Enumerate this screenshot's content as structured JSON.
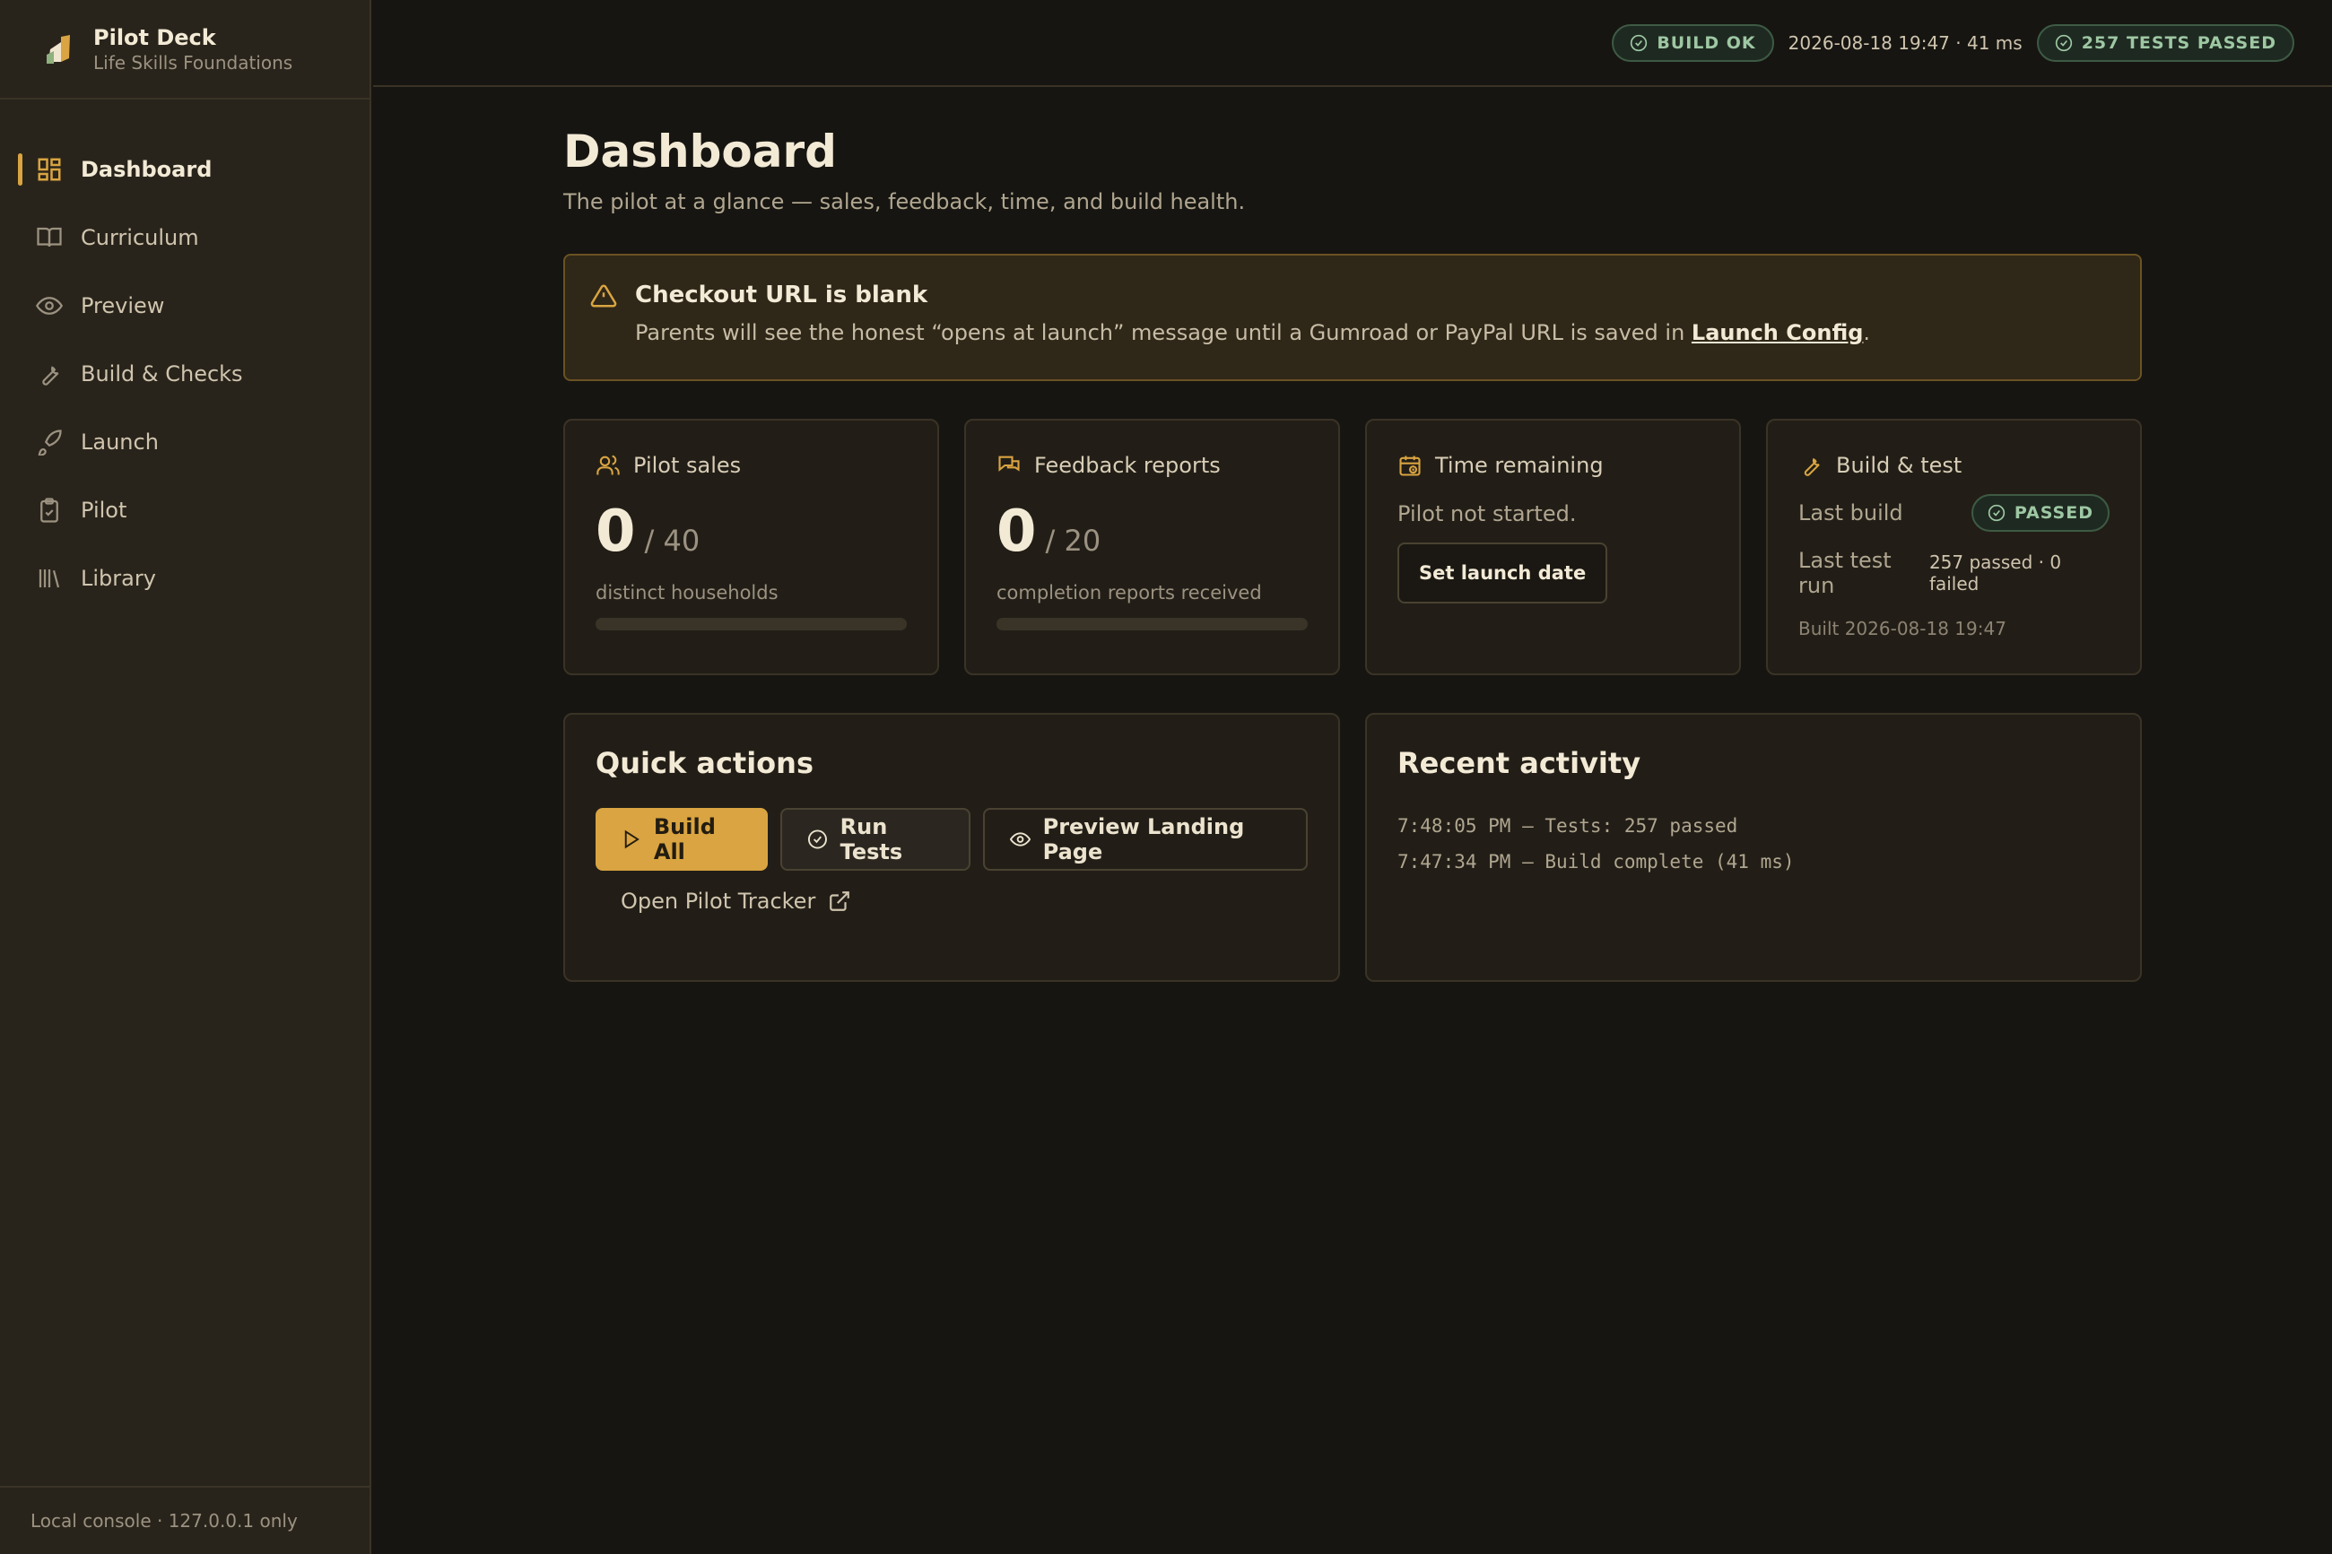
{
  "brand": {
    "name": "Pilot Deck",
    "subtitle": "Life Skills Foundations"
  },
  "sidebar": {
    "items": [
      {
        "label": "Dashboard",
        "icon": "dashboard-icon",
        "active": true
      },
      {
        "label": "Curriculum",
        "icon": "book-icon"
      },
      {
        "label": "Preview",
        "icon": "eye-icon"
      },
      {
        "label": "Build & Checks",
        "icon": "wrench-icon"
      },
      {
        "label": "Launch",
        "icon": "rocket-icon"
      },
      {
        "label": "Pilot",
        "icon": "clipboard-icon"
      },
      {
        "label": "Library",
        "icon": "library-icon"
      }
    ],
    "footer": "Local console · 127.0.0.1 only"
  },
  "topbar": {
    "build_status": "BUILD OK",
    "build_meta": "2026-08-18 19:47 · 41 ms",
    "tests_status": "257 TESTS PASSED"
  },
  "page": {
    "title": "Dashboard",
    "subtitle": "The pilot at a glance — sales, feedback, time, and build health."
  },
  "alert": {
    "title": "Checkout URL is blank",
    "body_before": "Parents will see the honest “opens at launch” message until a Gumroad or PayPal URL is saved in ",
    "link": "Launch Config",
    "body_after": "."
  },
  "stats": {
    "sales": {
      "title": "Pilot sales",
      "value": "0",
      "target": "/ 40",
      "caption": "distinct households",
      "progress": 0
    },
    "feedback": {
      "title": "Feedback reports",
      "value": "0",
      "target": "/ 20",
      "caption": "completion reports received",
      "progress": 0
    },
    "time": {
      "title": "Time remaining",
      "text": "Pilot not started.",
      "button": "Set launch date"
    },
    "build": {
      "title": "Build & test",
      "last_build_label": "Last build",
      "last_build_status": "PASSED",
      "last_test_label": "Last test run",
      "last_test_value": "257 passed · 0 failed",
      "built": "Built 2026-08-18 19:47"
    }
  },
  "quick_actions": {
    "title": "Quick actions",
    "build_all": "Build All",
    "run_tests": "Run Tests",
    "preview": "Preview Landing Page",
    "tracker": "Open Pilot Tracker"
  },
  "activity": {
    "title": "Recent activity",
    "lines": [
      "7:48:05 PM — Tests: 257 passed",
      "7:47:34 PM — Build complete (41 ms)"
    ]
  },
  "colors": {
    "accent": "#d9a441",
    "success": "#9ec7a3",
    "background": "#161511",
    "sidebar": "#29241b"
  }
}
